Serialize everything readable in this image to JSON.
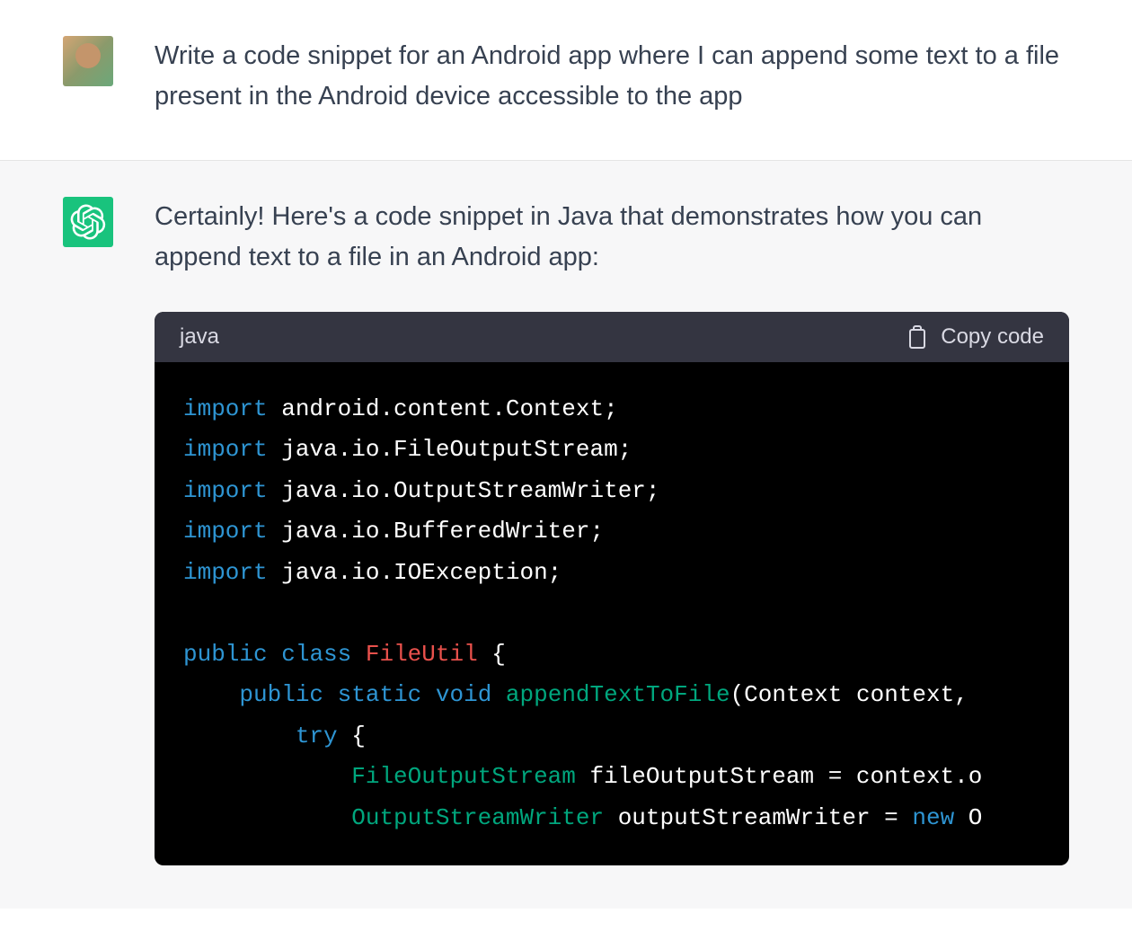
{
  "user_message": {
    "text": "Write a code snippet for an Android app where I can append some text to a file present in the Android device accessible to the app"
  },
  "assistant_message": {
    "intro": "Certainly! Here's a code snippet in Java that demonstrates how you can append text to a file in an Android app:",
    "code_block": {
      "language": "java",
      "copy_label": "Copy code",
      "lines": [
        {
          "tokens": [
            {
              "t": "import",
              "c": "kw"
            },
            {
              "t": " android.content.Context;",
              "c": ""
            }
          ]
        },
        {
          "tokens": [
            {
              "t": "import",
              "c": "kw"
            },
            {
              "t": " java.io.FileOutputStream;",
              "c": ""
            }
          ]
        },
        {
          "tokens": [
            {
              "t": "import",
              "c": "kw"
            },
            {
              "t": " java.io.OutputStreamWriter;",
              "c": ""
            }
          ]
        },
        {
          "tokens": [
            {
              "t": "import",
              "c": "kw"
            },
            {
              "t": " java.io.BufferedWriter;",
              "c": ""
            }
          ]
        },
        {
          "tokens": [
            {
              "t": "import",
              "c": "kw"
            },
            {
              "t": " java.io.IOException;",
              "c": ""
            }
          ]
        },
        {
          "tokens": [
            {
              "t": "",
              "c": ""
            }
          ]
        },
        {
          "tokens": [
            {
              "t": "public",
              "c": "kw"
            },
            {
              "t": " ",
              "c": ""
            },
            {
              "t": "class",
              "c": "kw"
            },
            {
              "t": " ",
              "c": ""
            },
            {
              "t": "FileUtil",
              "c": "cls"
            },
            {
              "t": " {",
              "c": ""
            }
          ]
        },
        {
          "tokens": [
            {
              "t": "    ",
              "c": ""
            },
            {
              "t": "public",
              "c": "kw"
            },
            {
              "t": " ",
              "c": ""
            },
            {
              "t": "static",
              "c": "kw"
            },
            {
              "t": " ",
              "c": ""
            },
            {
              "t": "void",
              "c": "kw"
            },
            {
              "t": " ",
              "c": ""
            },
            {
              "t": "appendTextToFile",
              "c": "fn"
            },
            {
              "t": "(Context context, ",
              "c": ""
            }
          ]
        },
        {
          "tokens": [
            {
              "t": "        ",
              "c": ""
            },
            {
              "t": "try",
              "c": "kw"
            },
            {
              "t": " {",
              "c": ""
            }
          ]
        },
        {
          "tokens": [
            {
              "t": "            ",
              "c": ""
            },
            {
              "t": "FileOutputStream",
              "c": "typ"
            },
            {
              "t": " fileOutputStream",
              "c": ""
            },
            {
              "t": " = context.o",
              "c": ""
            }
          ]
        },
        {
          "tokens": [
            {
              "t": "            ",
              "c": ""
            },
            {
              "t": "OutputStreamWriter",
              "c": "typ"
            },
            {
              "t": " outputStreamWriter",
              "c": ""
            },
            {
              "t": " = ",
              "c": ""
            },
            {
              "t": "new",
              "c": "new"
            },
            {
              "t": " O",
              "c": ""
            }
          ]
        }
      ]
    }
  }
}
